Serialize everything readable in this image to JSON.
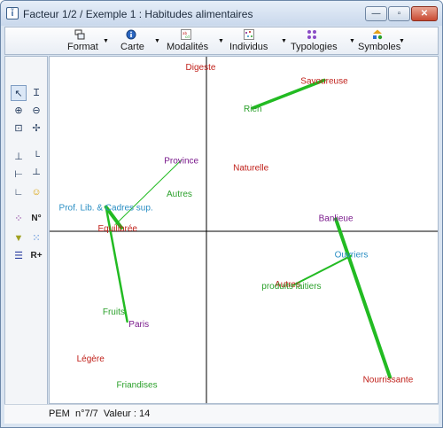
{
  "window": {
    "title": "Facteur 1/2 / Exemple 1 : Habitudes alimentaires",
    "app_icon_text": "ἶ",
    "controls": {
      "minimize": "—",
      "maximize": "▫",
      "close": "✕"
    }
  },
  "toolbar": {
    "items": [
      {
        "label": "Format",
        "icon": "format-icon"
      },
      {
        "label": "Carte",
        "icon": "info-map-icon"
      },
      {
        "label": "Modalités",
        "icon": "modalities-icon"
      },
      {
        "label": "Individus",
        "icon": "individuals-scatter-icon"
      },
      {
        "label": "Typologies",
        "icon": "typologies-icon"
      },
      {
        "label": "Symboles",
        "icon": "symbols-icon"
      }
    ]
  },
  "left_toolbar": {
    "buttons": [
      {
        "name": "select-arrow-icon",
        "glyph": "↖",
        "active": true
      },
      {
        "name": "text-cursor-icon",
        "glyph": "Ɪ"
      },
      {
        "name": "zoom-in-icon",
        "glyph": "⊕"
      },
      {
        "name": "zoom-out-icon",
        "glyph": "⊖"
      },
      {
        "name": "fit-view-icon",
        "glyph": "⊡"
      },
      {
        "name": "move-cross-icon",
        "glyph": "✢"
      },
      {
        "name": "axis-up-icon",
        "glyph": "⊥"
      },
      {
        "name": "axis-right-icon",
        "glyph": "└"
      },
      {
        "name": "axis-left-icon",
        "glyph": "⊢"
      },
      {
        "name": "axis-dash-icon",
        "glyph": "┴"
      },
      {
        "name": "axis-angle-icon",
        "glyph": "∟"
      },
      {
        "name": "smiley-icon",
        "glyph": "☺"
      },
      {
        "name": "scatter-small-icon",
        "glyph": "⁘"
      },
      {
        "name": "funnel-icon",
        "glyph": "▼"
      },
      {
        "name": "dots-icon",
        "glyph": "⁙"
      },
      {
        "name": "lines-icon",
        "glyph": "☰"
      }
    ],
    "n_label": "N°",
    "r_label": "R+"
  },
  "colors": {
    "red": "#c0201a",
    "green": "#2aa02a",
    "purple": "#7a1a8c",
    "blue": "#2b8fc4",
    "line_green": "#22bb22",
    "axis": "#000000"
  },
  "chart_data": {
    "type": "scatter",
    "title": "",
    "xlabel": "",
    "ylabel": "",
    "xlim": [
      -1,
      1
    ],
    "ylim": [
      -1,
      1
    ],
    "grid": false,
    "points": [
      {
        "label": "Digeste",
        "x": -0.03,
        "y": 0.95,
        "color": "red"
      },
      {
        "label": "Savoureuse",
        "x": 0.61,
        "y": 0.87,
        "color": "red"
      },
      {
        "label": "Rien",
        "x": 0.24,
        "y": 0.71,
        "color": "green"
      },
      {
        "label": "Province",
        "x": -0.13,
        "y": 0.41,
        "color": "purple"
      },
      {
        "label": "Naturelle",
        "x": 0.23,
        "y": 0.37,
        "color": "red"
      },
      {
        "label": "Autres",
        "x": -0.14,
        "y": 0.22,
        "color": "green"
      },
      {
        "label": "Prof. Lib. & Cadres sup.",
        "x": -0.52,
        "y": 0.14,
        "color": "blue"
      },
      {
        "label": "Banlieue",
        "x": 0.67,
        "y": 0.08,
        "color": "purple"
      },
      {
        "label": "Equilibrée",
        "x": -0.46,
        "y": 0.02,
        "color": "red"
      },
      {
        "label": "Ouvriers",
        "x": 0.75,
        "y": -0.13,
        "color": "blue"
      },
      {
        "label": "Autres",
        "x": 0.42,
        "y": -0.3,
        "color": "red"
      },
      {
        "label": "produits laitiers",
        "x": 0.44,
        "y": -0.31,
        "color": "green"
      },
      {
        "label": "Fruits",
        "x": -0.48,
        "y": -0.46,
        "color": "green"
      },
      {
        "label": "Paris",
        "x": -0.35,
        "y": -0.53,
        "color": "purple"
      },
      {
        "label": "Légère",
        "x": -0.6,
        "y": -0.73,
        "color": "red"
      },
      {
        "label": "Friandises",
        "x": -0.36,
        "y": -0.88,
        "color": "green"
      },
      {
        "label": "Nourrissante",
        "x": 0.94,
        "y": -0.85,
        "color": "red"
      }
    ],
    "links": [
      {
        "from": [
          0.61,
          0.87
        ],
        "to": [
          0.24,
          0.71
        ],
        "width": 3.5
      },
      {
        "from": [
          -0.13,
          0.41
        ],
        "to": [
          -0.47,
          0.04
        ],
        "width": 1
      },
      {
        "from": [
          -0.52,
          0.14
        ],
        "to": [
          -0.44,
          0.02
        ],
        "width": 4
      },
      {
        "from": [
          -0.52,
          0.14
        ],
        "to": [
          -0.41,
          -0.52
        ],
        "width": 2.5
      },
      {
        "from": [
          0.67,
          0.07
        ],
        "to": [
          0.95,
          -0.84
        ],
        "width": 4
      },
      {
        "from": [
          0.75,
          -0.14
        ],
        "to": [
          0.45,
          -0.31
        ],
        "width": 2
      }
    ]
  },
  "status": {
    "text": "PEM  n°7/7  Valeur : 14"
  }
}
